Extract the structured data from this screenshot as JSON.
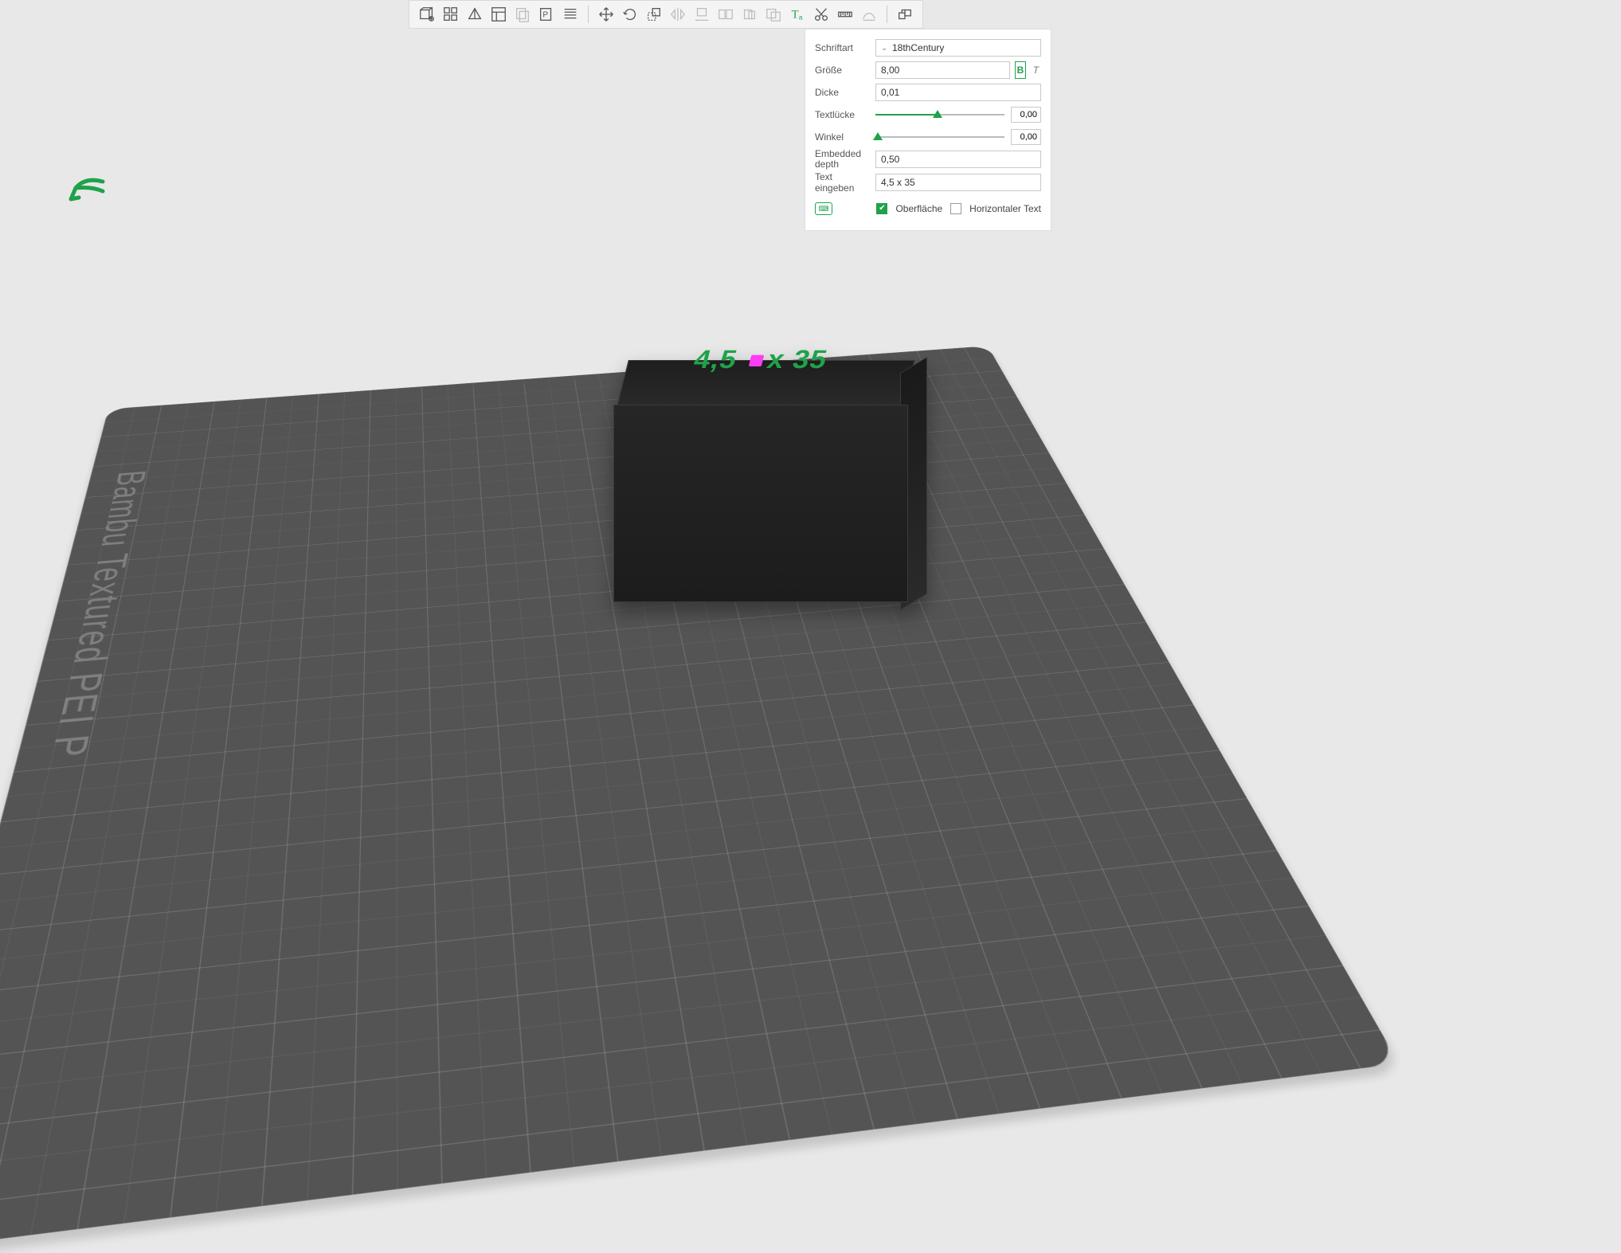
{
  "plate": {
    "label": "Bambu Textured PEI P"
  },
  "object_text": {
    "left": "4,5",
    "right": "35",
    "sep": "x"
  },
  "toolbar": {
    "buttons": [
      "add-primitive",
      "add-grid",
      "add-shape",
      "add-layout",
      "clone",
      "add-part",
      "add-text-group",
      "sep",
      "move",
      "rotate",
      "scale",
      "mirror",
      "flatten",
      "split",
      "merge",
      "boolean",
      "text",
      "cut",
      "measure",
      "support",
      "sep",
      "assembly"
    ]
  },
  "panel": {
    "font_label": "Schriftart",
    "font_value": "18thCentury",
    "size_label": "Größe",
    "size_value": "8,00",
    "bold": "B",
    "italic": "T",
    "thickness_label": "Dicke",
    "thickness_value": "0,01",
    "gap_label": "Textlücke",
    "gap_value": "0,00",
    "angle_label": "Winkel",
    "angle_value": "0,00",
    "embedded_label": "Embedded depth",
    "embedded_value": "0,50",
    "input_label": "Text eingeben",
    "input_value": "4,5 x 35",
    "surface_label": "Oberfläche",
    "horizontal_label": "Horizontaler Text"
  },
  "slider": {
    "gap_pct": 48,
    "angle_pct": 2
  }
}
